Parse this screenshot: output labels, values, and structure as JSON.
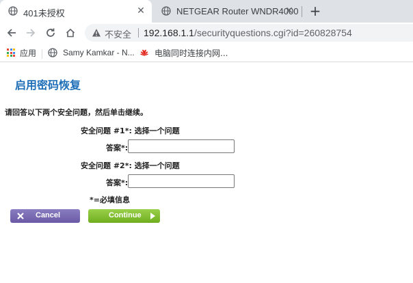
{
  "browser": {
    "tabs": [
      {
        "title": "401未授权",
        "active": true
      },
      {
        "title": "NETGEAR Router WNDR4000",
        "active": false
      }
    ],
    "address": {
      "security_label": "不安全",
      "url_host": "192.168.1.1",
      "url_path": "/securityquestions.cgi?id=260828754"
    },
    "bookmarks": [
      {
        "label": "应用",
        "icon": "apps-grid-icon"
      },
      {
        "label": "Samy Kamkar - N...",
        "icon": "globe-icon"
      },
      {
        "label": "电脑同时连接内网...",
        "icon": "huawei-icon"
      }
    ]
  },
  "page": {
    "heading": "启用密码恢复",
    "instructions": "请回答以下两个安全问题，然后单击继续。",
    "question1_label": "安全问题 #1*: 选择一个问题",
    "answer1_label": "答案*:",
    "answer1_value": "",
    "question2_label": "安全问题 #2*: 选择一个问题",
    "answer2_label": "答案*:",
    "answer2_value": "",
    "required_note": "*=必填信息",
    "cancel_label": "Cancel",
    "continue_label": "Continue"
  },
  "colors": {
    "heading": "#1f6fb8",
    "cancel_button": "#7667b3",
    "continue_button": "#82bf34",
    "tab_strip": "#dee1e6"
  }
}
